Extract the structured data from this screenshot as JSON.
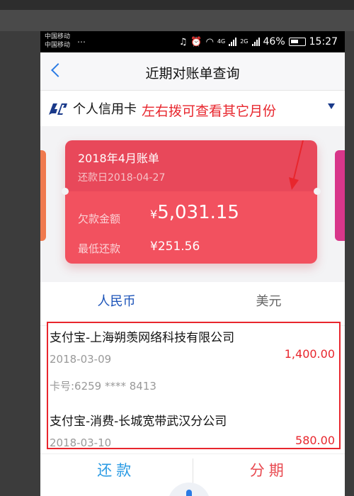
{
  "status_bar": {
    "carrier_line1": "中国移动",
    "carrier_line2": "中国移动",
    "overflow": "…",
    "net1": "4G",
    "net2": "2G",
    "battery": "46%",
    "time": "15:27"
  },
  "nav": {
    "title": "近期对账单查询"
  },
  "card_selector": {
    "card_name": "个人信用卡",
    "annotation": "左右拨可查看其它月份"
  },
  "bill": {
    "title": "2018年4月账单",
    "due_date": "还款日2018-04-27",
    "debt_label": "欠款金额",
    "debt_currency": "¥",
    "debt_value": "5,031.15",
    "min_label": "最低还款",
    "min_value": "¥251.56"
  },
  "tabs": [
    {
      "label": "人民币",
      "active": true
    },
    {
      "label": "美元",
      "active": false
    }
  ],
  "transactions": [
    {
      "merchant": "支付宝-上海朔羡网络科技有限公司",
      "date": "2018-03-09",
      "card": "卡号:6259 **** 8413",
      "amount": "1,400.00"
    },
    {
      "merchant": "支付宝-消费-长城宽带武汉分公司",
      "date": "2018-03-10",
      "amount": "580.00"
    }
  ],
  "actions": {
    "repay": "还款",
    "installment": "分期"
  },
  "colors": {
    "accent_blue": "#2b7be4",
    "bill_red": "#f2515f",
    "annotation_red": "#e8262d"
  }
}
